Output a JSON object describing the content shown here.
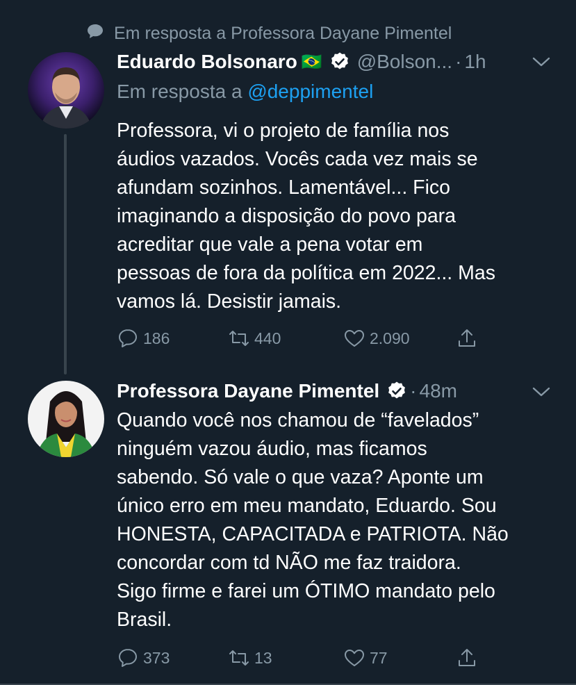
{
  "context": {
    "text": "Em resposta a Professora Dayane Pimentel",
    "icon": "speech-bubble-icon"
  },
  "tweet1": {
    "name": "Eduardo Bolsonaro",
    "flag": "🇧🇷",
    "handle": "@Bolson...",
    "separator": "·",
    "time": "1h",
    "reply_prefix": "Em resposta a ",
    "reply_mention": "@deppimentel",
    "text": "Professora, vi o projeto de família nos\náudios vazados. Vocês cada vez mais se\nafundam sozinhos. Lamentável... Fico\nimaginando a disposição do povo para\nacreditar que vale a pena votar em\npessoas de fora da política em 2022... Mas\nvamos lá. Desistir jamais.",
    "replies": "186",
    "retweets": "440",
    "likes": "2.090"
  },
  "tweet2": {
    "name": "Professora Dayane Pimentel",
    "separator": "·",
    "time": "48m",
    "text": "Quando você nos chamou de “favelados”\nninguém vazou áudio, mas ficamos\nsabendo. Só vale o que vaza? Aponte um\núnico erro em meu mandato, Eduardo. Sou\nHONESTA, CAPACITADA e PATRIOTA. Não\nconcordar com td NÃO me faz traidora.\nSigo firme e farei um ÓTIMO mandato pelo\nBrasil.",
    "replies": "373",
    "retweets": "13",
    "likes": "77"
  },
  "colors": {
    "background": "#15202b",
    "muted": "#8899a6",
    "link": "#1da1f2",
    "thread_line": "#38444d"
  }
}
